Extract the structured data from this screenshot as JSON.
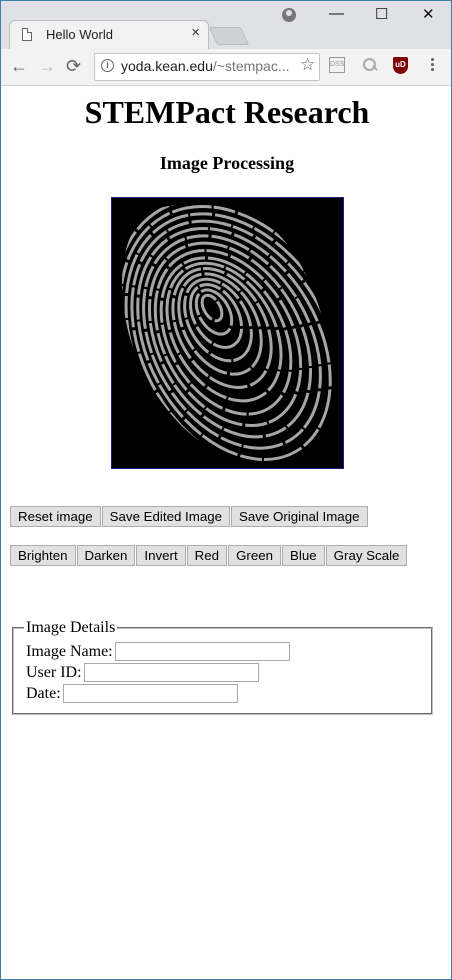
{
  "browser": {
    "tab_title": "Hello World",
    "tab_close": "×",
    "url_host": "yoda.kean.edu",
    "url_rest": "/~stempac...",
    "window_minimize": "—",
    "window_maximize": "☐",
    "window_close": "✕",
    "back_glyph": "←",
    "forward_glyph": "→",
    "reload_glyph": "⟳",
    "star_glyph": "☆",
    "ext_dss": "DSS",
    "ext_ublock": "uD"
  },
  "page": {
    "title": "STEMPact Research",
    "subtitle": "Image Processing",
    "image_name": "fingerprint-image",
    "buttons_row1": [
      "Reset image",
      "Save Edited Image",
      "Save Original Image"
    ],
    "buttons_row2": [
      "Brighten",
      "Darken",
      "Invert",
      "Red",
      "Green",
      "Blue",
      "Gray Scale"
    ],
    "details": {
      "legend": "Image Details",
      "fields": [
        {
          "label": "Image Name:",
          "value": ""
        },
        {
          "label": "User ID:",
          "value": ""
        },
        {
          "label": "Date:",
          "value": ""
        }
      ]
    }
  },
  "colors": {
    "window_border": "#3c7fb1",
    "image_border": "#1a1a8c",
    "ridge": "#a6a6a6",
    "button_bg": "#e1e1e1"
  }
}
